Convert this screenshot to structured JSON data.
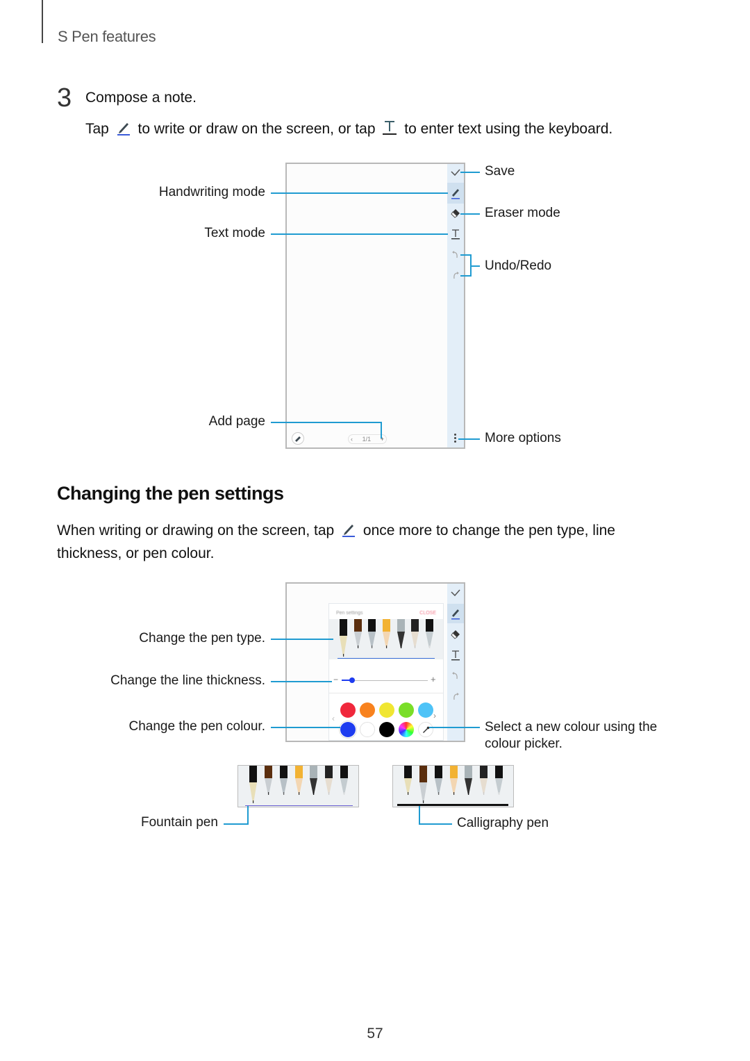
{
  "header": {
    "section": "S Pen features"
  },
  "step": {
    "number": "3",
    "title": "Compose a note.",
    "desc_part1": "Tap",
    "desc_part2": "to write or draw on the screen, or tap",
    "desc_part3": "to enter text using the keyboard.",
    "pen_icon": "pen-icon",
    "text_icon": "text-mode-icon"
  },
  "figure1": {
    "callouts_left": {
      "handwriting": "Handwriting mode",
      "text": "Text mode",
      "add_page": "Add page"
    },
    "callouts_right": {
      "save": "Save",
      "eraser": "Eraser mode",
      "undo_redo": "Undo/Redo",
      "more": "More options"
    },
    "toolbar_icons": [
      "check-icon",
      "pen-icon",
      "eraser-icon",
      "text-icon",
      "undo-icon",
      "redo-icon"
    ],
    "bottom_bar": {
      "page_indicator": "1/1",
      "prev": "‹",
      "add": "+"
    }
  },
  "section": {
    "title": "Changing the pen settings",
    "para_part1": "When writing or drawing on the screen, tap",
    "para_part2": "once more to change the pen type, line thickness, or pen colour."
  },
  "figure2": {
    "callouts_left": {
      "pen_type": "Change the pen type.",
      "line_thickness": "Change the line thickness.",
      "pen_colour": "Change the pen colour."
    },
    "callout_right": "Select a new colour using the colour picker.",
    "panel": {
      "title": "Pen settings",
      "close": "CLOSE",
      "thickness_minus": "−",
      "thickness_plus": "+",
      "thickness_fraction": 0.12
    },
    "colours_row1": [
      "#f0283c",
      "#f8821e",
      "#f0e632",
      "#7ade28",
      "#4ec3f7"
    ],
    "colours_row2": [
      "#1e3cf0",
      "#ffffff",
      "#000000",
      "rainbow",
      "picker"
    ],
    "pens": [
      "fountain",
      "calligraphy",
      "brush",
      "pencil",
      "marker",
      "highlighter",
      "fineliner"
    ]
  },
  "figure3": {
    "fountain": "Fountain pen",
    "calligraphy": "Calligraphy pen"
  },
  "page_number": "57"
}
